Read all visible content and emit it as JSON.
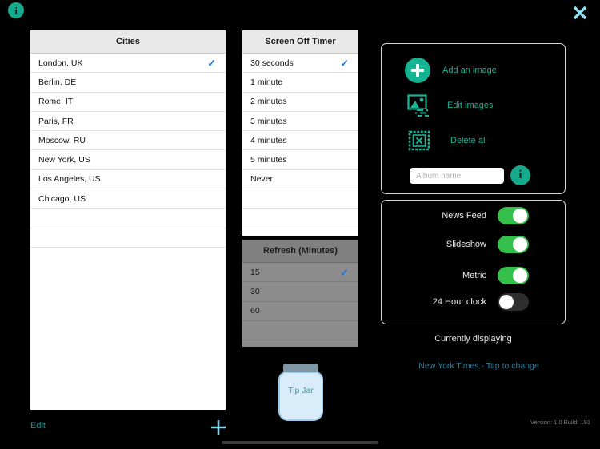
{
  "window": {
    "info_icon_label": "i",
    "close_icon_label": "close-icon"
  },
  "cities_panel": {
    "title": "Cities",
    "selected": "London, UK",
    "rows": [
      {
        "label": "London, UK",
        "checked": true
      },
      {
        "label": "Berlin, DE",
        "checked": false
      },
      {
        "label": "Rome, IT",
        "checked": false
      },
      {
        "label": "Paris, FR",
        "checked": false
      },
      {
        "label": "Moscow, RU",
        "checked": false
      },
      {
        "label": "New York, US",
        "checked": false
      },
      {
        "label": "Los Angeles, US",
        "checked": false
      },
      {
        "label": "Chicago, US",
        "checked": false
      }
    ]
  },
  "timer_panel": {
    "title": "Screen Off Timer",
    "selected": "30 seconds",
    "rows": [
      {
        "label": "30 seconds",
        "checked": true
      },
      {
        "label": "1 minute",
        "checked": false
      },
      {
        "label": "2 minutes",
        "checked": false
      },
      {
        "label": "3 minutes",
        "checked": false
      },
      {
        "label": "4 minutes",
        "checked": false
      },
      {
        "label": "5 minutes",
        "checked": false
      },
      {
        "label": "Never",
        "checked": false
      }
    ]
  },
  "refresh_panel": {
    "title": "Refresh (Minutes)",
    "selected": "15",
    "disabled": true,
    "rows": [
      {
        "label": "15",
        "checked": true
      },
      {
        "label": "30",
        "checked": false
      },
      {
        "label": "60",
        "checked": false
      }
    ]
  },
  "toolbar": {
    "edit_label": "Edit",
    "add_icon": "plus-icon"
  },
  "tip_jar": {
    "label": "Tip Jar"
  },
  "images_card": {
    "add_image_label": "Add an image",
    "edit_images_label": "Edit images",
    "delete_all_label": "Delete all",
    "album_name_value": "",
    "album_name_placeholder": "Album name",
    "album_info_label": "i"
  },
  "toggles_card": {
    "rows": [
      {
        "label": "News Feed",
        "on": true
      },
      {
        "label": "Slideshow",
        "on": true
      },
      {
        "label": "Metric",
        "on": true
      },
      {
        "label": "24 Hour clock",
        "on": false
      }
    ]
  },
  "footer": {
    "currently_displaying_label": "Currently displaying",
    "feed_link_label": "New York Times - Tap to change",
    "version_label": "Version: 1.0 Build: 191"
  },
  "colors": {
    "accent_teal": "#19b396",
    "check_blue": "#1c78e8",
    "toggle_on_green": "#34c04a",
    "link_blue": "#2b7fa0",
    "close_cyan": "#93dff4",
    "plus_cyan": "#7fd6ef"
  }
}
